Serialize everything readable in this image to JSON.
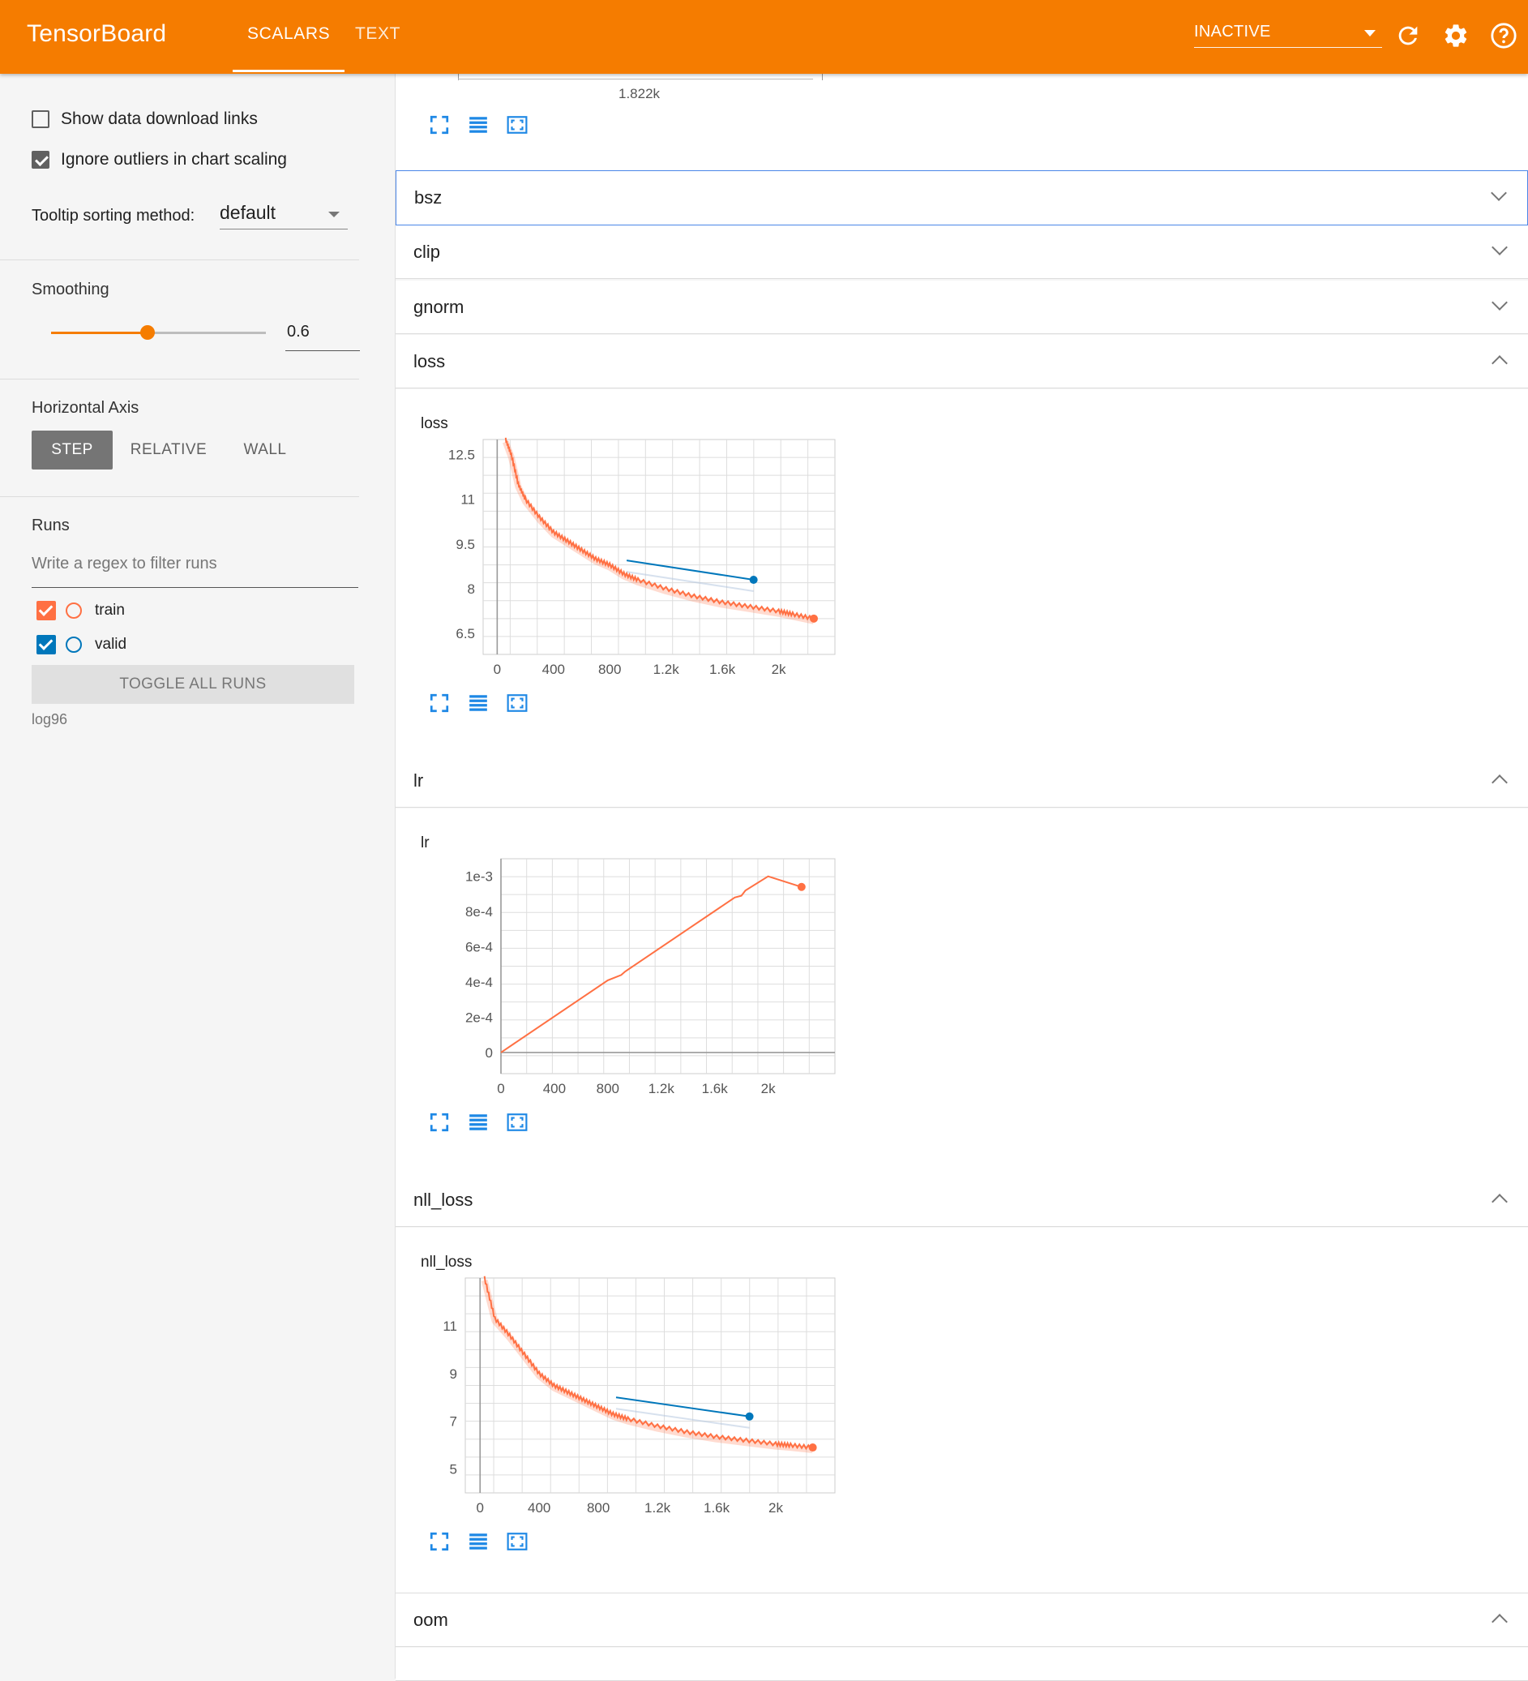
{
  "header": {
    "brand": "TensorBoard",
    "tabs": [
      {
        "label": "SCALARS",
        "active": true
      },
      {
        "label": "TEXT",
        "active": false
      }
    ],
    "runs_status": "INACTIVE",
    "icons": [
      "refresh-icon",
      "settings-gear-icon",
      "help-icon"
    ],
    "accent_color": "#f57c00"
  },
  "sidebar": {
    "show_download_links": {
      "label": "Show data download links",
      "checked": false
    },
    "ignore_outliers": {
      "label": "Ignore outliers in chart scaling",
      "checked": true
    },
    "tooltip_sorting": {
      "label": "Tooltip sorting method:",
      "value": "default"
    },
    "smoothing": {
      "label": "Smoothing",
      "value": "0.6",
      "fraction": 0.6
    },
    "horizontal_axis": {
      "label": "Horizontal Axis",
      "options": [
        "STEP",
        "RELATIVE",
        "WALL"
      ],
      "selected": "STEP"
    },
    "runs": {
      "label": "Runs",
      "filter_placeholder": "Write a regex to filter runs",
      "items": [
        {
          "name": "train",
          "checked": true,
          "color": "#ff7043"
        },
        {
          "name": "valid",
          "checked": true,
          "color": "#0077bb"
        }
      ],
      "toggle_label": "TOGGLE ALL RUNS",
      "logdir": "log96"
    }
  },
  "main": {
    "top_card": {
      "axis_label": "1.822k"
    },
    "panes": [
      {
        "name": "bsz",
        "expanded": false
      },
      {
        "name": "clip",
        "expanded": false
      },
      {
        "name": "gnorm",
        "expanded": false
      },
      {
        "name": "loss",
        "expanded": true
      },
      {
        "name": "lr",
        "expanded": true
      },
      {
        "name": "nll_loss",
        "expanded": true
      },
      {
        "name": "oom",
        "expanded": true
      }
    ]
  },
  "chart_data": [
    {
      "type": "line",
      "title": "loss",
      "x_ticks": [
        "0",
        "400",
        "800",
        "1.2k",
        "1.6k",
        "2k"
      ],
      "y_ticks": [
        "12.5",
        "11",
        "9.5",
        "8",
        "6.5"
      ],
      "series": [
        {
          "name": "train",
          "color": "#ff7043",
          "x": [
            60,
            100,
            150,
            200,
            300,
            400,
            500,
            600,
            700,
            800,
            900,
            1000,
            1200,
            1400,
            1600,
            1800,
            2000,
            2100,
            2250
          ],
          "y": [
            13.0,
            12.5,
            11.5,
            11.0,
            10.4,
            9.9,
            9.6,
            9.3,
            9.0,
            8.8,
            8.5,
            8.3,
            8.0,
            7.75,
            7.55,
            7.4,
            7.25,
            7.15,
            7.0
          ]
        },
        {
          "name": "valid",
          "color": "#0077bb",
          "x": [
            920,
            1822
          ],
          "y": [
            8.95,
            8.3
          ]
        }
      ]
    },
    {
      "type": "line",
      "title": "lr",
      "x_ticks": [
        "0",
        "400",
        "800",
        "1.2k",
        "1.6k",
        "2k"
      ],
      "y_ticks": [
        "1e-3",
        "8e-4",
        "6e-4",
        "4e-4",
        "2e-4",
        "0"
      ],
      "series": [
        {
          "name": "train",
          "color": "#ff7043",
          "x": [
            0,
            800,
            900,
            930,
            1750,
            1800,
            1830,
            2000,
            2250
          ],
          "y": [
            0,
            0.00041,
            0.00044,
            0.00046,
            0.00088,
            0.00089,
            0.00092,
            0.001,
            0.00094
          ]
        }
      ]
    },
    {
      "type": "line",
      "title": "nll_loss",
      "x_ticks": [
        "0",
        "400",
        "800",
        "1.2k",
        "1.6k",
        "2k"
      ],
      "y_ticks": [
        "11",
        "9",
        "7",
        "5"
      ],
      "series": [
        {
          "name": "train",
          "color": "#ff7043",
          "x": [
            30,
            100,
            200,
            300,
            400,
            500,
            600,
            700,
            800,
            900,
            1000,
            1200,
            1400,
            1600,
            1800,
            2000,
            2100,
            2250
          ],
          "y": [
            13.0,
            11.3,
            10.6,
            9.8,
            9.0,
            8.5,
            8.2,
            7.9,
            7.6,
            7.3,
            7.1,
            6.8,
            6.55,
            6.35,
            6.2,
            6.05,
            6.0,
            5.9
          ]
        },
        {
          "name": "valid",
          "color": "#0077bb",
          "x": [
            920,
            1822
          ],
          "y": [
            8.0,
            7.2
          ]
        }
      ]
    }
  ]
}
